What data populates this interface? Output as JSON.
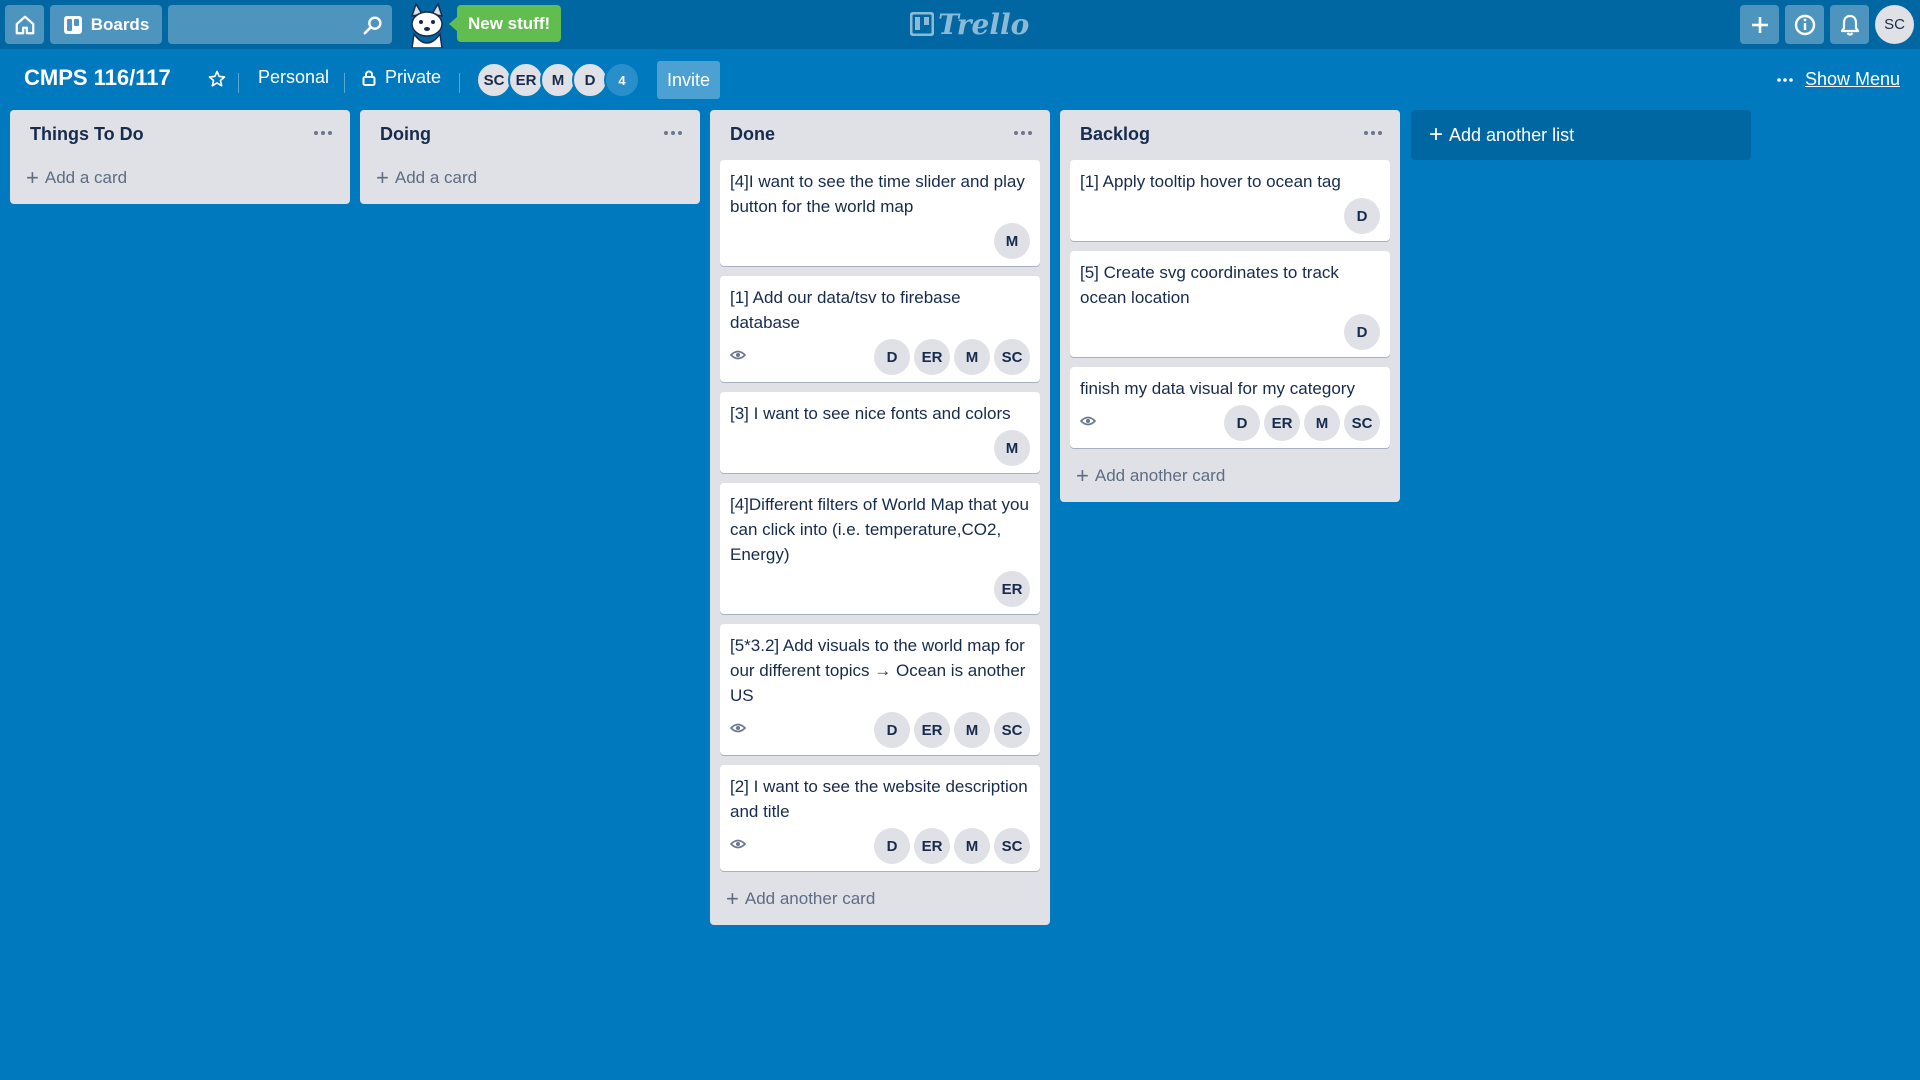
{
  "header": {
    "boards_label": "Boards",
    "new_stuff_label": "New stuff!",
    "logo_text": "Trello",
    "user_initials": "SC"
  },
  "board": {
    "title": "CMPS 116/117",
    "team_label": "Personal",
    "visibility_label": "Private",
    "members": [
      "SC",
      "ER",
      "M",
      "D"
    ],
    "extra_members": "4",
    "invite_label": "Invite",
    "show_menu_label": "Show Menu",
    "add_list_label": "Add another list"
  },
  "lists": [
    {
      "title": "Things To Do",
      "add_label": "Add a card",
      "cards": []
    },
    {
      "title": "Doing",
      "add_label": "Add a card",
      "cards": []
    },
    {
      "title": "Done",
      "add_label": "Add another card",
      "cards": [
        {
          "title": "[4]I want to see the time slider and play button for the world map",
          "watch": false,
          "members": [
            "M"
          ]
        },
        {
          "title": "[1] Add our data/tsv to firebase database",
          "watch": true,
          "members": [
            "D",
            "ER",
            "M",
            "SC"
          ]
        },
        {
          "title": "[3] I want to see nice fonts and colors",
          "watch": false,
          "members": [
            "M"
          ]
        },
        {
          "title": "[4]Different filters of World Map that you can click into (i.e. temperature,CO2, Energy)",
          "watch": false,
          "members": [
            "ER"
          ]
        },
        {
          "title": "[5*3.2] Add visuals to the world map for our different topics → Ocean is another US",
          "watch": true,
          "members": [
            "D",
            "ER",
            "M",
            "SC"
          ]
        },
        {
          "title": "[2] I want to see the website description and title",
          "watch": true,
          "members": [
            "D",
            "ER",
            "M",
            "SC"
          ]
        }
      ]
    },
    {
      "title": "Backlog",
      "add_label": "Add another card",
      "cards": [
        {
          "title": "[1] Apply tooltip hover to ocean tag",
          "watch": false,
          "members": [
            "D"
          ]
        },
        {
          "title": "[5] Create svg coordinates to track ocean location",
          "watch": false,
          "members": [
            "D"
          ]
        },
        {
          "title": "finish my data visual for my category",
          "watch": true,
          "members": [
            "D",
            "ER",
            "M",
            "SC"
          ]
        }
      ]
    }
  ],
  "colors": {
    "board_bg": "#0079bf",
    "header_bg": "#0067a3",
    "list_bg": "#dfe1e6",
    "new_stuff_bg": "#61bd4f"
  }
}
